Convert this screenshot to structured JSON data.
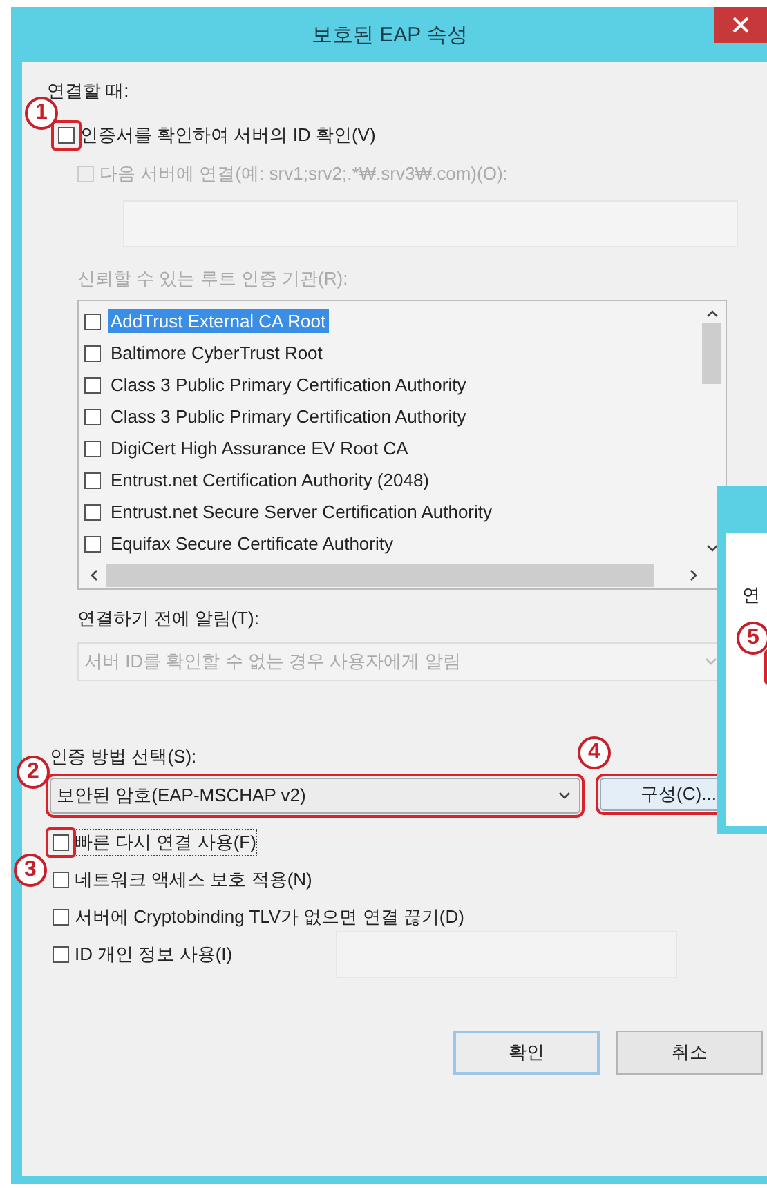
{
  "window": {
    "title": "보호된 EAP 속성"
  },
  "connect_section": {
    "label": "연결할 때:",
    "verify_cert": {
      "label": "인증서를 확인하여 서버의 ID 확인(V)",
      "checked": false,
      "highlight": true,
      "marker": "1"
    },
    "connect_servers": {
      "label": "다음 서버에 연결(예: srv1;srv2;.*₩.srv3₩.com)(O):",
      "checked": false,
      "disabled": true
    },
    "trusted_label": "신뢰할 수 있는 루트 인증 기관(R):",
    "ca_list": [
      {
        "label": "AddTrust External CA Root",
        "checked": false,
        "selected": true
      },
      {
        "label": "Baltimore CyberTrust Root",
        "checked": false,
        "selected": false
      },
      {
        "label": "Class 3 Public Primary Certification Authority",
        "checked": false,
        "selected": false
      },
      {
        "label": "Class 3 Public Primary Certification Authority",
        "checked": false,
        "selected": false
      },
      {
        "label": "DigiCert High Assurance EV Root CA",
        "checked": false,
        "selected": false
      },
      {
        "label": "Entrust.net Certification Authority (2048)",
        "checked": false,
        "selected": false
      },
      {
        "label": "Entrust.net Secure Server Certification Authority",
        "checked": false,
        "selected": false
      },
      {
        "label": "Equifax Secure Certificate Authority",
        "checked": false,
        "selected": false
      }
    ],
    "notify_label": "연결하기 전에 알림(T):",
    "notify_select": {
      "value": "서버 ID를 확인할 수 없는 경우 사용자에게 알림",
      "disabled": true
    }
  },
  "auth": {
    "label": "인증 방법 선택(S):",
    "select": {
      "value": "보안된 암호(EAP-MSCHAP v2)",
      "highlight": true,
      "marker": "2"
    },
    "configure": {
      "label": "구성(C)...",
      "highlight": true,
      "marker": "4"
    }
  },
  "options": [
    {
      "label": "빠른 다시 연결 사용(F)",
      "checked": false,
      "highlight": true,
      "marker": "3"
    },
    {
      "label": "네트워크 액세스 보호 적용(N)",
      "checked": false
    },
    {
      "label": "서버에 Cryptobinding TLV가 없으면 연결 끊기(D)",
      "checked": false
    },
    {
      "label": "ID 개인 정보 사용(I)",
      "checked": false
    }
  ],
  "buttons": [
    {
      "label": "확인",
      "default": true
    },
    {
      "label": "취소",
      "default": false
    }
  ],
  "side_dialog": {
    "text": "연",
    "marker": "5"
  }
}
